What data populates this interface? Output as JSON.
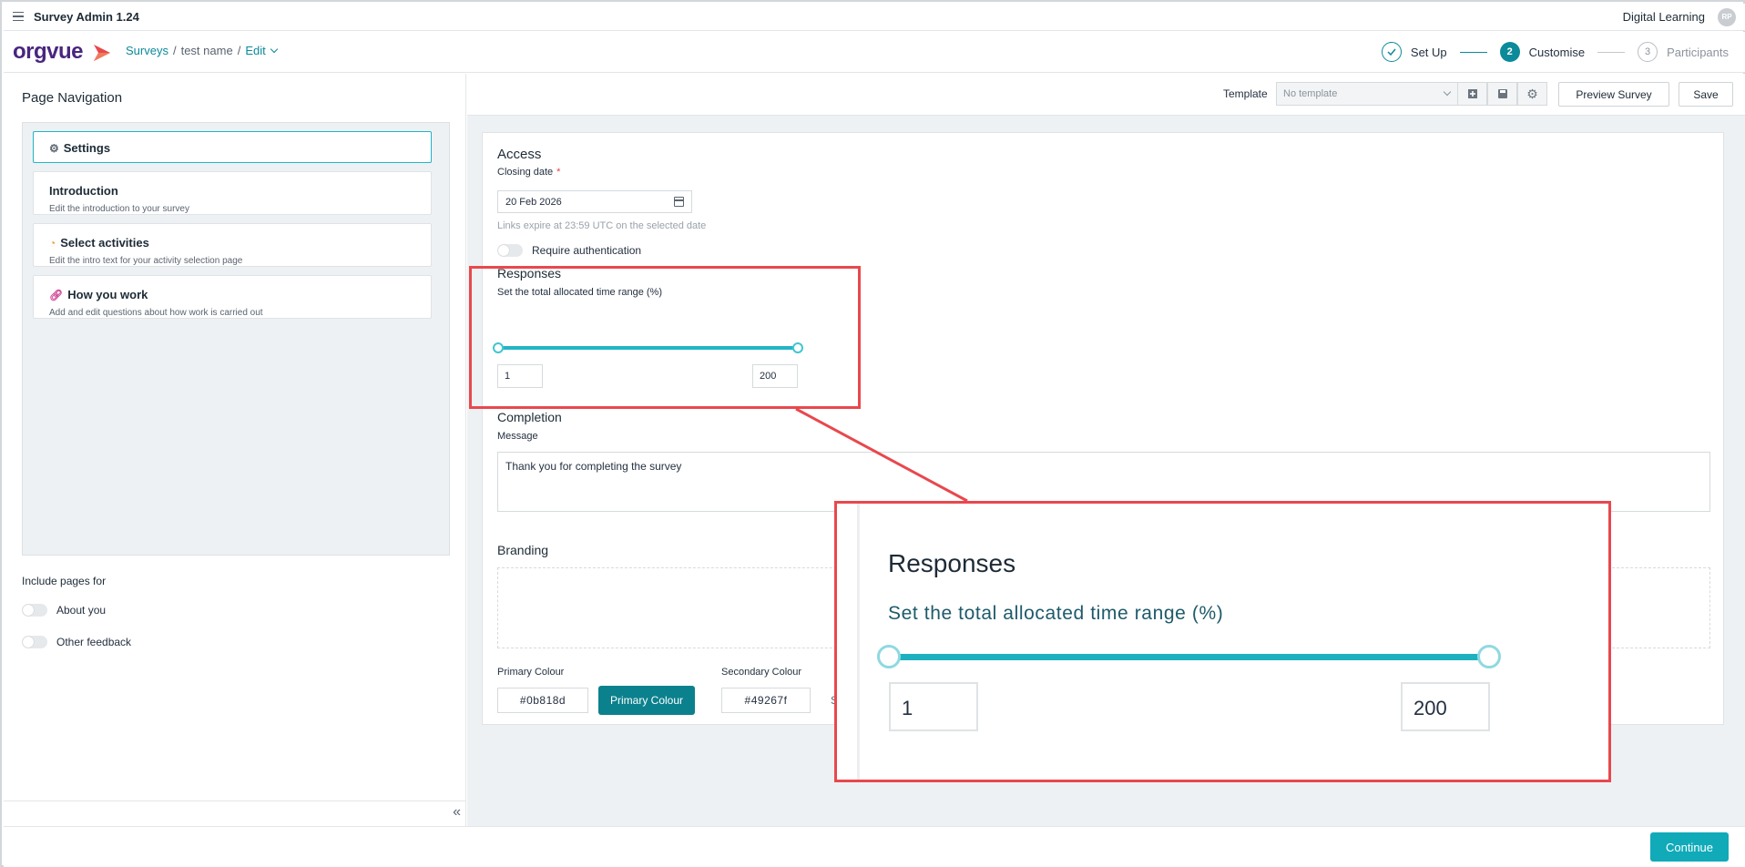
{
  "app": {
    "title": "Survey Admin 1.24",
    "org": "Digital Learning",
    "avatar_initials": "RP",
    "logo_text": "orgvue"
  },
  "breadcrumb": {
    "root": "Surveys",
    "sep1": "/",
    "survey": "test name",
    "sep2": "/",
    "current": "Edit"
  },
  "stepper": [
    {
      "number": "1",
      "label": "Set Up",
      "state": "done"
    },
    {
      "number": "2",
      "label": "Customise",
      "state": "active"
    },
    {
      "number": "3",
      "label": "Participants",
      "state": "todo"
    }
  ],
  "page_nav": {
    "title": "Page Navigation",
    "items": [
      {
        "icon": "gear-icon",
        "title": "Settings",
        "desc": ""
      },
      {
        "icon": "",
        "title": "Introduction",
        "desc": "Edit the introduction to your survey"
      },
      {
        "icon": "activity-icon",
        "title": "Select activities",
        "desc": "Edit the intro text for your activity selection page"
      },
      {
        "icon": "link-icon",
        "title": "How you work",
        "desc": "Add and edit questions about how work is carried out"
      }
    ],
    "include_title": "Include pages for",
    "toggles": [
      "About you",
      "Other feedback"
    ]
  },
  "toolbar": {
    "template_label": "Template",
    "template_placeholder": "No template",
    "preview_label": "Preview Survey",
    "save_label": "Save"
  },
  "access": {
    "title": "Access",
    "closing_label": "Closing date",
    "required_mark": "*",
    "closing_value": "20 Feb 2026",
    "hint": "Links expire at 23:59 UTC on the selected date",
    "auth_label": "Require authentication"
  },
  "responses": {
    "title": "Responses",
    "range_label": "Set the total allocated time range (%)",
    "min_value": "1",
    "max_value": "200"
  },
  "completion": {
    "title": "Completion",
    "message_label": "Message",
    "message_value": "Thank you for completing the survey"
  },
  "branding": {
    "title": "Branding",
    "primary_label": "Primary Colour",
    "primary_value": "#0b818d",
    "primary_button": "Primary Colour",
    "secondary_label": "Secondary Colour",
    "secondary_value": "#49267f",
    "truncated": "S"
  },
  "footer": {
    "continue_label": "Continue"
  },
  "colors": {
    "accent": "#0b8a9a",
    "brand_purple": "#49267f",
    "highlight": "#e8484d"
  }
}
